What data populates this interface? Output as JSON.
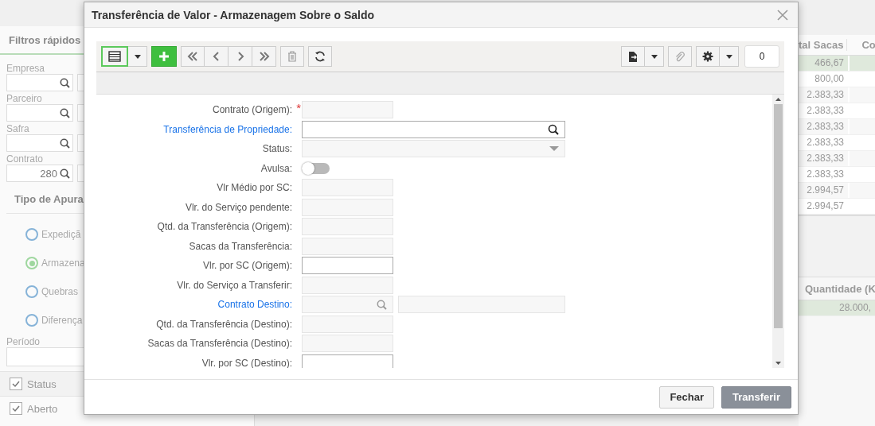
{
  "background": {
    "filters_title": "Filtros rápidos",
    "filters": [
      {
        "label": "Empresa"
      },
      {
        "label": "Parceiro"
      },
      {
        "label": "Safra"
      },
      {
        "label": "Contrato",
        "value": "280"
      }
    ],
    "group_title": "Tipo de Apura",
    "radios": [
      {
        "label": "Expediçã",
        "selected": false
      },
      {
        "label": "Armazena",
        "selected": true
      },
      {
        "label": "Quebras",
        "selected": false
      },
      {
        "label": "Diferença",
        "selected": false
      }
    ],
    "period_label": "Período",
    "checks": [
      {
        "label": "Status",
        "checked": true
      },
      {
        "label": "Aberto",
        "checked": true
      }
    ],
    "table": {
      "columns": [
        "tal Sacas",
        "Co"
      ],
      "rows": [
        {
          "value": "466,67",
          "selected": true
        },
        {
          "value": "800,00",
          "selected": false
        },
        {
          "value": "2.383,33",
          "selected": false
        },
        {
          "value": "2.383,33",
          "selected": false
        },
        {
          "value": "2.383,33",
          "selected": false
        },
        {
          "value": "2.383,33",
          "selected": false
        },
        {
          "value": "2.383,33",
          "selected": false
        },
        {
          "value": "2.383,33",
          "selected": false
        },
        {
          "value": "2.994,57",
          "selected": false
        },
        {
          "value": "2.994,57",
          "selected": false
        }
      ]
    },
    "table2": {
      "columns": [
        "Quantidade (K"
      ],
      "rows": [
        {
          "value": "28.000,",
          "selected": true
        }
      ]
    }
  },
  "dialog": {
    "title": "Transferência de Valor - Armazenagem Sobre o Saldo",
    "badge": "0",
    "fields": [
      {
        "label": "Contrato (Origem):",
        "kind": "text",
        "marker": "*",
        "link": false,
        "enabled": false
      },
      {
        "label": "Transferência de Propriedade:",
        "kind": "search",
        "link": true,
        "enabled": true
      },
      {
        "label": "Status:",
        "kind": "select",
        "link": false,
        "enabled": false
      },
      {
        "label": "Avulsa:",
        "kind": "toggle",
        "link": false,
        "on": false
      },
      {
        "label": "Vlr Médio por SC:",
        "kind": "text",
        "link": false,
        "enabled": false
      },
      {
        "label": "Vlr. do Serviço pendente:",
        "kind": "text",
        "link": false,
        "enabled": false
      },
      {
        "label": "Qtd. da Transferência (Origem):",
        "kind": "text",
        "link": false,
        "enabled": false
      },
      {
        "label": "Sacas da Transferência:",
        "kind": "text",
        "link": false,
        "enabled": false
      },
      {
        "label": "Vlr. por SC (Origem):",
        "kind": "text",
        "link": false,
        "enabled": true
      },
      {
        "label": "Vlr. do Serviço a Transferir:",
        "kind": "text",
        "link": false,
        "enabled": false
      },
      {
        "label": "Contrato Destino:",
        "kind": "lookup",
        "link": true,
        "enabled": false
      },
      {
        "label": "Qtd. da Transferência (Destino):",
        "kind": "text",
        "link": false,
        "enabled": false
      },
      {
        "label": "Sacas da Transferência (Destino):",
        "kind": "text",
        "link": false,
        "enabled": false
      },
      {
        "label": "Vlr. por SC (Destino):",
        "kind": "text",
        "link": false,
        "enabled": true
      }
    ],
    "buttons": [
      {
        "label": "Fechar",
        "kind": "secondary"
      },
      {
        "label": "Transferir",
        "kind": "primary"
      }
    ]
  }
}
